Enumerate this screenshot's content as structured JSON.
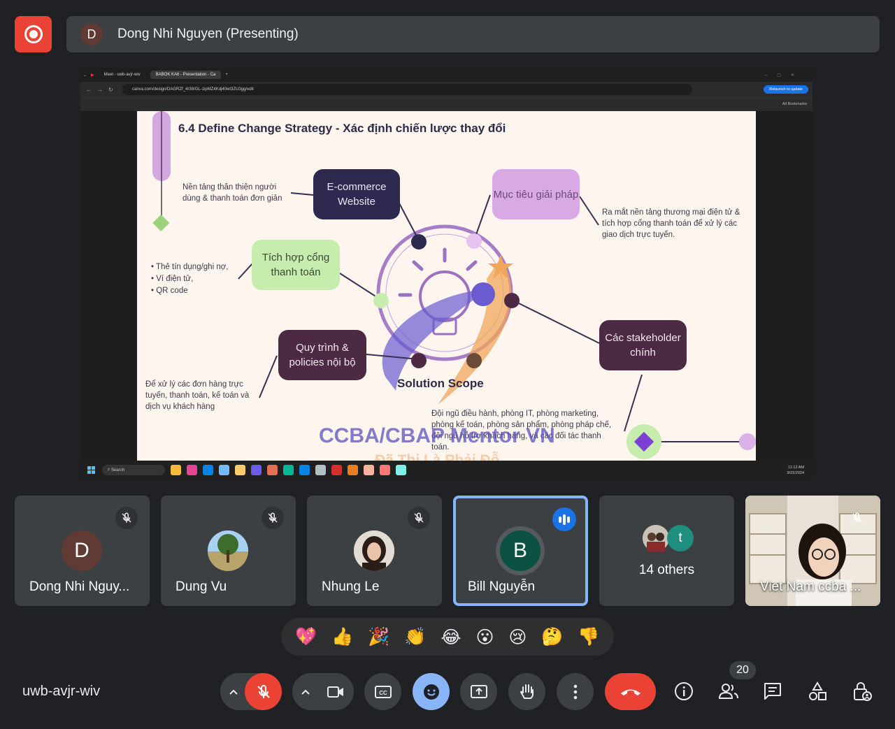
{
  "presenter": {
    "avatar_letter": "D",
    "label": "Dong Nhi Nguyen (Presenting)"
  },
  "browser": {
    "tabs": [
      "Meet - uwb-avjr-wiv",
      "BABOK KA6 - Presentation - Ca"
    ],
    "url": "canva.com/design/DAGRZf_4r38/GL-1ipMZ4Kdj40wt3ZU3gg/edit",
    "relaunch_label": "Relaunch to update",
    "bookmarks_label": "All Bookmarks"
  },
  "slide": {
    "title": "6.4 Define Change Strategy - Xác định chiến lược thay đổi",
    "nodes": {
      "ecommerce": "E-commerce Website",
      "goal": "Mục tiêu giải pháp",
      "payment": "Tích hợp cổng thanh toán",
      "process": "Quy trình & policies nội bộ",
      "stakeholders": "Các stakeholder chính"
    },
    "ecommerce_note": "Nền tảng thân thiện người dùng & thanh toán đơn giản",
    "goal_note": "Ra mắt nền tảng thương mại điện tử & tích hợp cổng thanh toán để xử lý các giao dịch trực tuyến.",
    "payment_bullets": [
      "Thẻ tín dụng/ghi nợ,",
      "Ví điện tử,",
      "QR code"
    ],
    "process_note": "Để xử lý các đơn hàng trực tuyến, thanh toán, kế toán và dịch vụ khách hàng",
    "stakeholder_note": "Đội ngũ điều hành, phòng IT, phòng marketing, phòng kế toán, phòng sản phẩm, phòng pháp chế, đội ngũ hỗ trợ khách hàng, và các đối tác thanh toán.",
    "center_label": "Solution Scope",
    "watermark_main": "CCBA/CBAP Mentor VN",
    "watermark_sub": "Đã Thi Là Phải Đỗ",
    "colors": {
      "dark": "#2e2a4f",
      "maroon": "#4d2a44",
      "lilac": "#d9a9e6",
      "green": "#c6ecae"
    }
  },
  "taskbar": {
    "search_placeholder": "Search",
    "time": "11:12 AM",
    "date": "9/22/2024"
  },
  "participants": [
    {
      "name": "Dong Nhi Nguy...",
      "avatar": "D",
      "avatar_color": "#5f3b33",
      "muted": true
    },
    {
      "name": "Dung Vu",
      "avatar": "tree-photo",
      "muted": true
    },
    {
      "name": "Nhung Le",
      "avatar": "portrait-photo",
      "muted": true
    },
    {
      "name": "Bill Nguyễn",
      "avatar": "B",
      "avatar_color": "#0b5144",
      "speaking": true
    },
    {
      "name": "14 others",
      "avatar": "t",
      "avatar_color": "#1e8e7e"
    },
    {
      "name": "Viet Nam ccba ...",
      "avatar": "video-feed",
      "muted": true
    }
  ],
  "reactions": [
    "💖",
    "👍",
    "🎉",
    "👏",
    "😂",
    "😮",
    "😢",
    "🤔",
    "👎"
  ],
  "meeting_code": "uwb-avjr-wiv",
  "people_count": "20",
  "icons": [
    "record-icon",
    "mic-off-icon",
    "camera-icon",
    "captions-icon",
    "emoji-icon",
    "present-icon",
    "raise-hand-icon",
    "more-icon",
    "end-call-icon",
    "info-icon",
    "people-icon",
    "chat-icon",
    "activities-icon",
    "host-controls-icon"
  ],
  "theme": {
    "background": "#202124",
    "tile": "#3c4043",
    "danger": "#ea4335",
    "accent": "#8ab4f8"
  }
}
